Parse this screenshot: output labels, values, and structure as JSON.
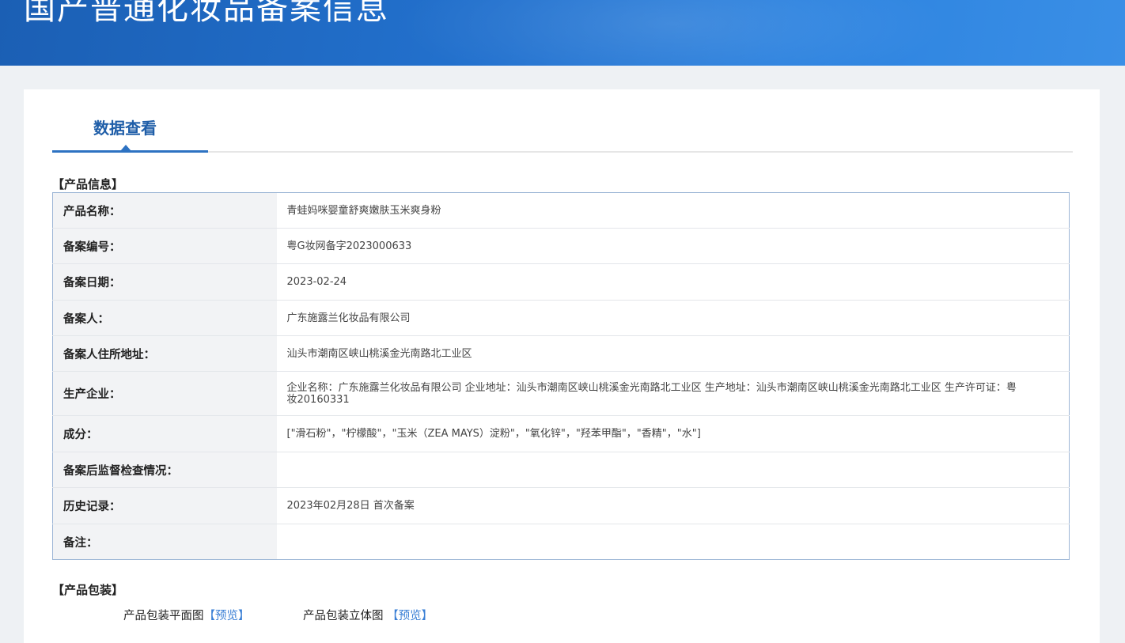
{
  "header": {
    "title": "国产普通化妆品备案信息"
  },
  "tab": {
    "label": "数据查看"
  },
  "product_info": {
    "section_title": "【产品信息】",
    "rows": [
      {
        "label": "产品名称：",
        "value": "青蛙妈咪婴童舒爽嫩肤玉米爽身粉"
      },
      {
        "label": "备案编号：",
        "value": "粤G妆网备字2023000633"
      },
      {
        "label": "备案日期：",
        "value": "2023-02-24"
      },
      {
        "label": "备案人：",
        "value": "广东施露兰化妆品有限公司"
      },
      {
        "label": "备案人住所地址：",
        "value": "汕头市潮南区峡山桃溪金光南路北工业区"
      },
      {
        "label": "生产企业：",
        "value": "企业名称：广东施露兰化妆品有限公司 企业地址：汕头市潮南区峡山桃溪金光南路北工业区 生产地址：汕头市潮南区峡山桃溪金光南路北工业区 生产许可证：粤妆20160331"
      },
      {
        "label": "成分：",
        "value": "[\"滑石粉\"，\"柠檬酸\"，\"玉米（ZEA MAYS）淀粉\"，\"氧化锌\"，\"羟苯甲酯\"，\"香精\"，\"水\"]"
      },
      {
        "label": "备案后监督检查情况：",
        "value": ""
      },
      {
        "label": "历史记录：",
        "value": "2023年02月28日 首次备案"
      },
      {
        "label": "备注：",
        "value": ""
      }
    ]
  },
  "packaging": {
    "section_title": "【产品包装】",
    "flat_label": "产品包装平面图",
    "flat_preview": "【预览】",
    "stereo_label": "产品包装立体图",
    "stereo_preview": "【预览】"
  }
}
